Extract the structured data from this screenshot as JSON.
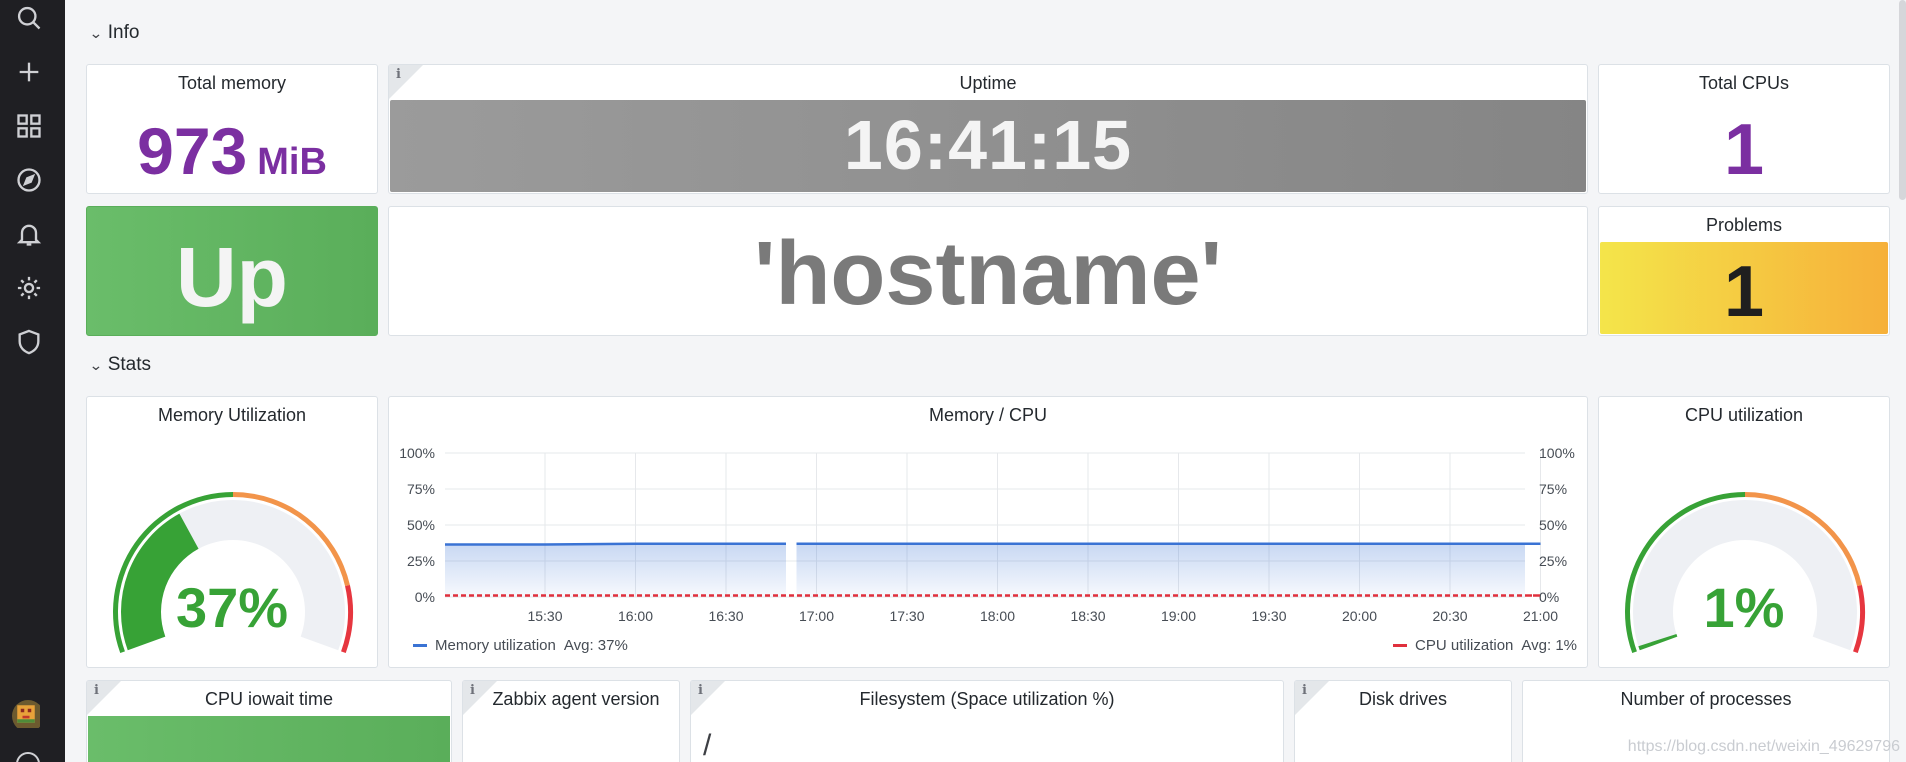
{
  "sidebar": {
    "icons": [
      "search-icon",
      "plus-icon",
      "dashboards-icon",
      "explore-icon",
      "alerting-icon",
      "settings-icon",
      "shield-icon"
    ]
  },
  "rows": {
    "info": "Info",
    "stats": "Stats"
  },
  "panels": {
    "total_memory": {
      "title": "Total memory",
      "value": "973",
      "unit": "MiB"
    },
    "uptime": {
      "title": "Uptime",
      "value": "16:41:15"
    },
    "total_cpus": {
      "title": "Total CPUs",
      "value": "1"
    },
    "status": {
      "value": "Up"
    },
    "hostname": {
      "value": "'hostname'"
    },
    "problems": {
      "title": "Problems",
      "value": "1"
    },
    "memory_util": {
      "title": "Memory Utilization",
      "value": "37%",
      "level": 37
    },
    "memory_cpu": {
      "title": "Memory / CPU"
    },
    "cpu_util": {
      "title": "CPU utilization",
      "value": "1%",
      "level": 1
    },
    "cpu_iowait": {
      "title": "CPU iowait time"
    },
    "zabbix_agent": {
      "title": "Zabbix agent version"
    },
    "filesystem": {
      "title": "Filesystem (Space utilization %)",
      "first_row": "/"
    },
    "disk_drives": {
      "title": "Disk drives"
    },
    "num_processes": {
      "title": "Number of processes"
    }
  },
  "colors": {
    "purple": "#7b2fa1",
    "green": "#5fb55f",
    "gauge_green": "#37a236",
    "orange": "#f2944a",
    "red": "#e6363f",
    "memory_series": "#3a73d4",
    "cpu_series": "#e0303d",
    "uptime_bg": "#8c8c8c",
    "problems_a": "#f4e54a",
    "problems_b": "#f6b03a"
  },
  "chart_data": {
    "type": "line",
    "title": "Memory / CPU",
    "x": [
      "15:30",
      "16:00",
      "16:30",
      "17:00",
      "17:30",
      "18:00",
      "18:30",
      "19:00",
      "19:30",
      "20:00",
      "20:30",
      "21:00"
    ],
    "y_left_ticks": [
      "100%",
      "75%",
      "50%",
      "25%",
      "0%"
    ],
    "y_right_ticks": [
      "100%",
      "75%",
      "50%",
      "25%",
      "0%"
    ],
    "ylim": [
      0,
      100
    ],
    "grid": true,
    "legend_position": "bottom",
    "series": [
      {
        "name": "Memory utilization",
        "avg_label": "Avg: 37%",
        "color": "#3a73d4",
        "values": [
          36.5,
          37,
          37,
          37,
          37,
          37,
          37,
          37,
          37,
          37,
          37,
          37
        ],
        "gap_between": [
          "16:30",
          "17:00"
        ]
      },
      {
        "name": "CPU utilization",
        "avg_label": "Avg: 1%",
        "color": "#e0303d",
        "values": [
          1,
          1,
          1,
          1,
          1,
          1,
          1,
          1,
          1,
          1,
          1,
          1
        ]
      }
    ]
  },
  "watermark": "https://blog.csdn.net/weixin_49629796"
}
